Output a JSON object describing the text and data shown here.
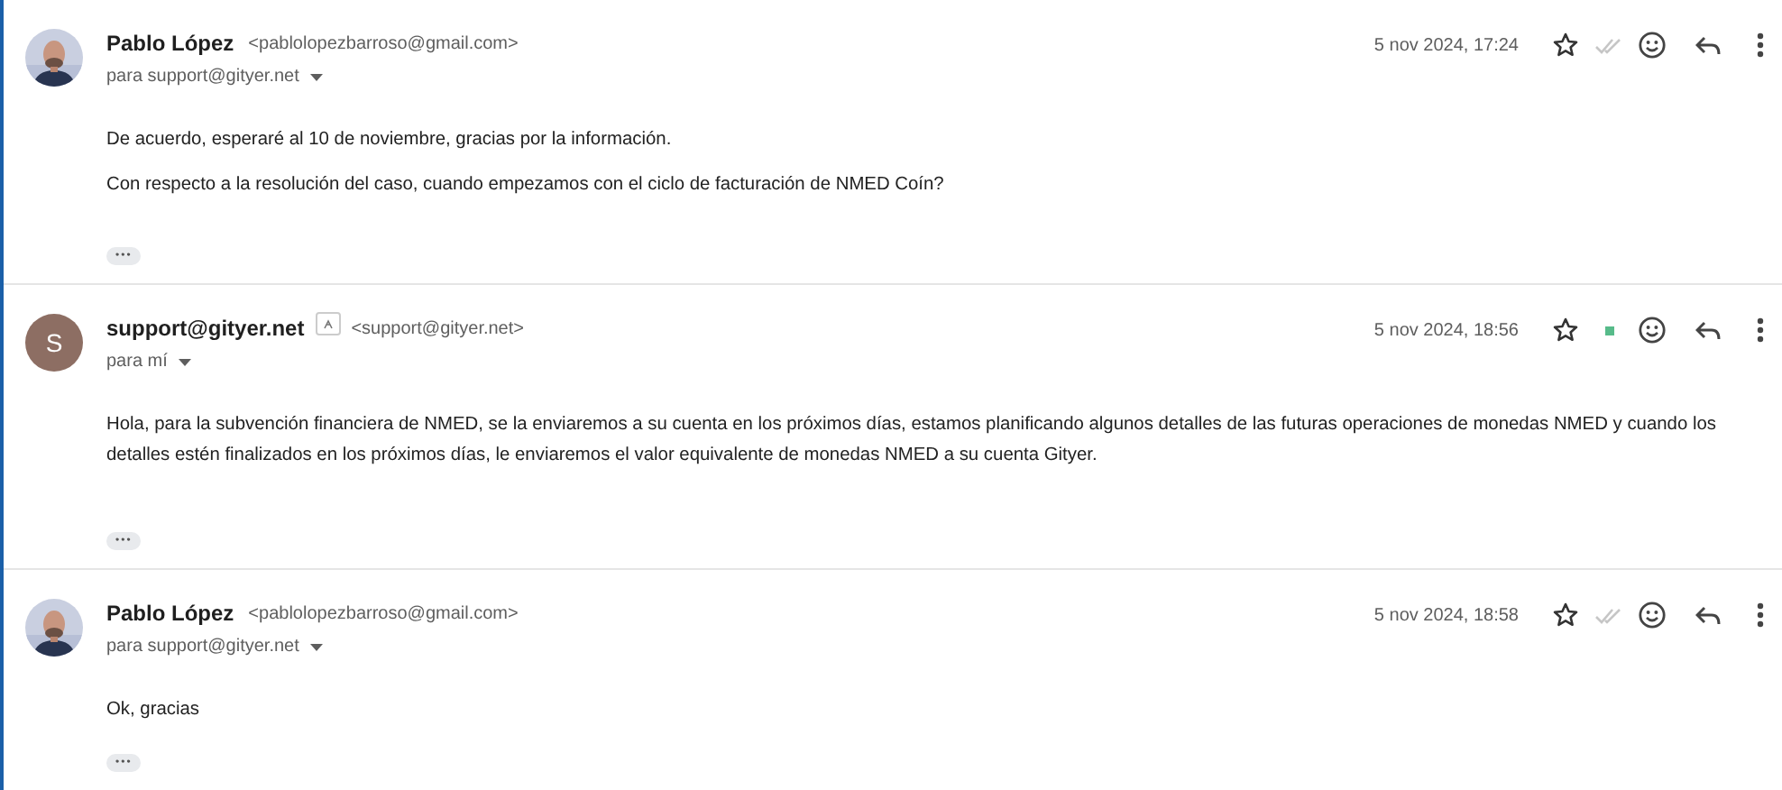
{
  "messages": [
    {
      "sender": "Pablo López",
      "sender_email": "<pablolopezbarroso@gmail.com>",
      "avatar": {
        "kind": "picture"
      },
      "show_sender_icon": false,
      "recipient": "para support@gityer.net",
      "date": "5 nov 2024, 17:24",
      "starred": false,
      "status": {
        "kind": "read-check"
      },
      "body": [
        "De acuerdo, esperaré al 10 de noviembre, gracias por la información.",
        "Con respecto a la resolución del caso, cuando empezamos con el ciclo de facturación de NMED Coín?"
      ],
      "more": "•••"
    },
    {
      "sender": "support@gityer.net",
      "sender_email": "<support@gityer.net>",
      "avatar": {
        "kind": "letter",
        "letter": "S",
        "color": "#8d6e63"
      },
      "show_sender_icon": true,
      "recipient": "para mí",
      "date": "5 nov 2024, 18:56",
      "starred": false,
      "status": {
        "kind": "online-dot",
        "color": "#57bb8a"
      },
      "body": [
        "Hola, para la subvención financiera de NMED, se la enviaremos a su cuenta en los próximos días, estamos planificando algunos detalles de las futuras operaciones de monedas NMED y cuando los detalles estén finalizados en los próximos días, le enviaremos el valor equivalente de monedas NMED a su cuenta Gityer."
      ],
      "more": "•••"
    },
    {
      "sender": "Pablo López",
      "sender_email": "<pablolopezbarroso@gmail.com>",
      "avatar": {
        "kind": "picture"
      },
      "show_sender_icon": false,
      "recipient": "para support@gityer.net",
      "date": "5 nov 2024, 18:58",
      "starred": false,
      "status": {
        "kind": "read-check"
      },
      "body": [
        "Ok, gracias"
      ],
      "more": "•••"
    }
  ]
}
